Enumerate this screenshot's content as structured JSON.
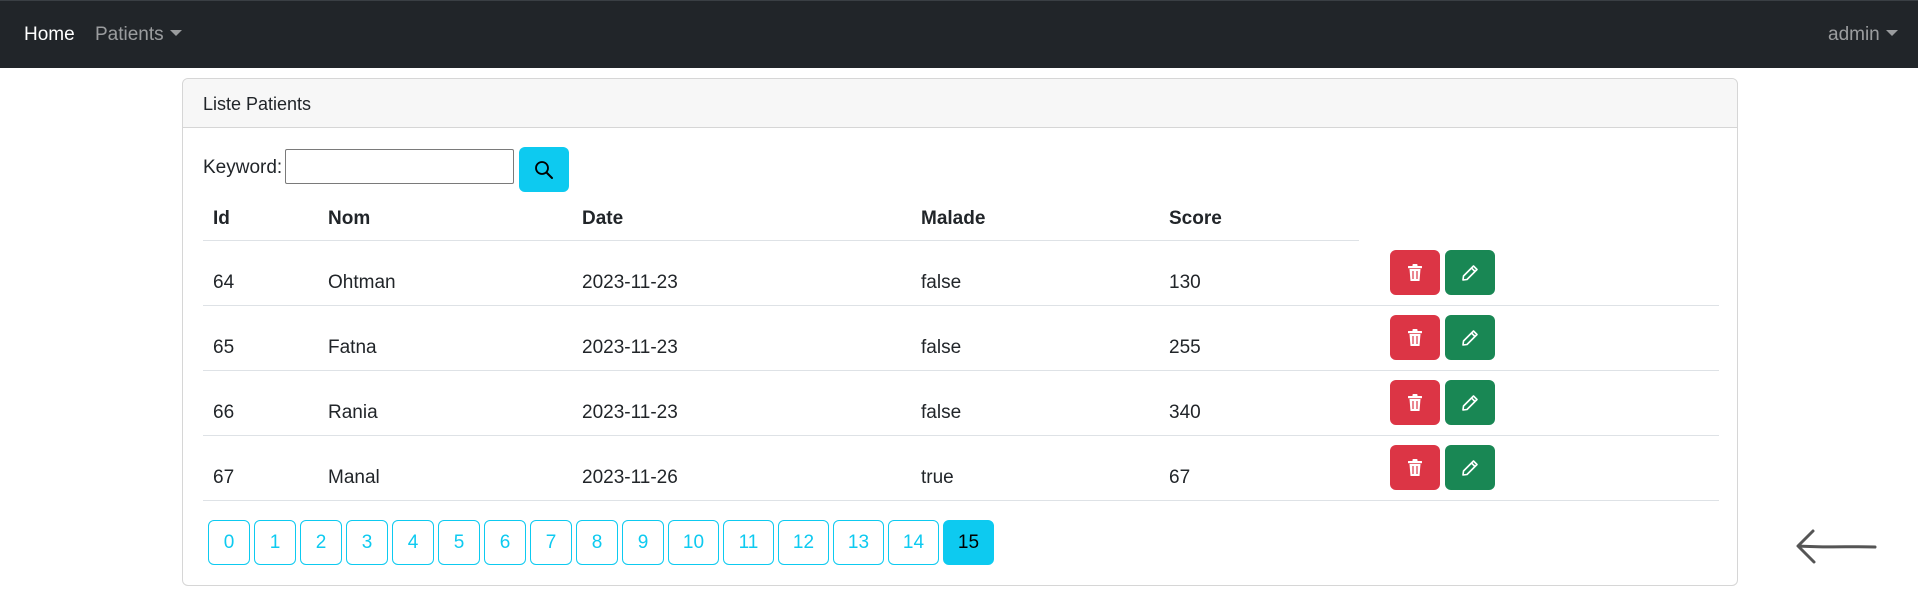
{
  "navbar": {
    "home_label": "Home",
    "patients_label": "Patients",
    "user_label": "admin"
  },
  "card": {
    "title": "Liste Patients"
  },
  "search": {
    "label": "Keyword:",
    "value": "",
    "placeholder": ""
  },
  "table": {
    "headers": [
      "Id",
      "Nom",
      "Date",
      "Malade",
      "Score"
    ],
    "rows": [
      {
        "id": "64",
        "nom": "Ohtman",
        "date": "2023-11-23",
        "malade": "false",
        "score": "130"
      },
      {
        "id": "65",
        "nom": "Fatna",
        "date": "2023-11-23",
        "malade": "false",
        "score": "255"
      },
      {
        "id": "66",
        "nom": "Rania",
        "date": "2023-11-23",
        "malade": "false",
        "score": "340"
      },
      {
        "id": "67",
        "nom": "Manal",
        "date": "2023-11-26",
        "malade": "true",
        "score": "67"
      }
    ],
    "delete_icon": "trash-icon",
    "edit_icon": "pencil-icon"
  },
  "pagination": {
    "pages": [
      "0",
      "1",
      "2",
      "3",
      "4",
      "5",
      "6",
      "7",
      "8",
      "9",
      "10",
      "11",
      "12",
      "13",
      "14",
      "15"
    ],
    "current": "15"
  },
  "colors": {
    "navbar_bg": "#212529",
    "info": "#0dcaf0",
    "danger": "#dc3545",
    "success": "#198754"
  }
}
